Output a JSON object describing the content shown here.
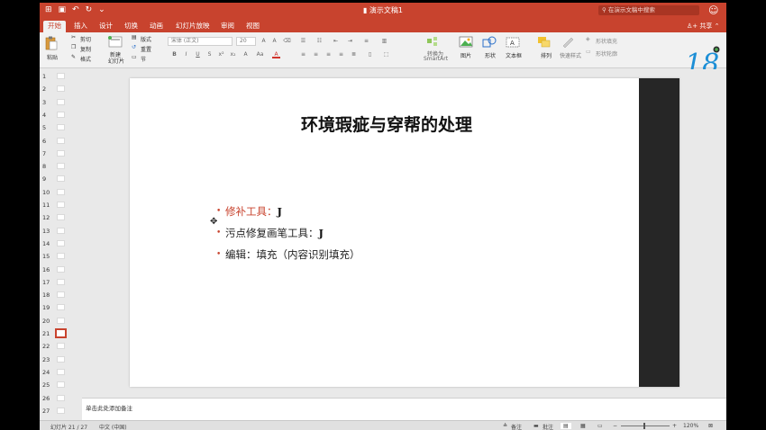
{
  "titlebar": {
    "doc_title": "演示文稿1",
    "search_placeholder": "在演示文稿中搜索",
    "qa_icons": [
      "grid-icon",
      "save-icon",
      "undo-icon",
      "redo-icon",
      "customize-icon"
    ]
  },
  "tabs": [
    {
      "label": "开始",
      "active": true
    },
    {
      "label": "插入"
    },
    {
      "label": "设计"
    },
    {
      "label": "切换"
    },
    {
      "label": "动画"
    },
    {
      "label": "幻灯片放映"
    },
    {
      "label": "审阅"
    },
    {
      "label": "视图"
    }
  ],
  "share_label": "共享",
  "ribbon": {
    "paste": "粘贴",
    "cut": "剪切",
    "copy": "复制",
    "format": "格式",
    "new_slide_1": "新建",
    "new_slide_2": "幻灯片",
    "layout": "版式",
    "reset": "重置",
    "section": "节",
    "font_name": "宋体 (正文)",
    "font_size": "20",
    "convert_1": "转换为",
    "convert_2": "SmartArt",
    "picture": "图片",
    "shape": "形状",
    "textbox": "文本框",
    "arrange": "排列",
    "quick_style": "快速样式",
    "shape_fill": "形状填充",
    "shape_outline": "形状轮廓"
  },
  "logo_text": "18",
  "colors": {
    "accent": "#c8432e",
    "dark_bar": "#262626"
  },
  "thumbs": [
    "1",
    "2",
    "3",
    "4",
    "5",
    "6",
    "7",
    "8",
    "9",
    "10",
    "11",
    "12",
    "13",
    "14",
    "15",
    "16",
    "17",
    "18",
    "19",
    "20",
    "21",
    "22",
    "23",
    "24",
    "25",
    "26",
    "27"
  ],
  "selected_slide": "21",
  "slide": {
    "title": "环境瑕疵与穿帮的处理",
    "bullets": [
      {
        "text": "修补工具：",
        "key": "J"
      },
      {
        "text": "污点修复画笔工具：",
        "key": "J"
      },
      {
        "text": "编辑：填充（内容识别填充）",
        "key": ""
      }
    ]
  },
  "notes_placeholder": "单击此处添加备注",
  "status": {
    "slide_info": "幻灯片 21 / 27",
    "language": "中文 (中国)",
    "notes": "备注",
    "comments": "批注",
    "zoom": "120%"
  }
}
